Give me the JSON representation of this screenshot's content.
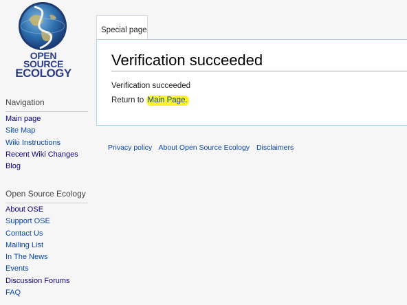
{
  "logo": {
    "line1": "OPEN",
    "line2": "SOURCE",
    "line3": "ECOLOGY"
  },
  "tabs": [
    {
      "label": "Special page"
    }
  ],
  "page": {
    "title": "Verification succeeded",
    "message": "Verification succeeded",
    "return_prefix": "Return to ",
    "return_link": "Main Page."
  },
  "sidebar": {
    "navigation": {
      "heading": "Navigation",
      "items": [
        {
          "label": "Main page"
        },
        {
          "label": "Site Map"
        },
        {
          "label": "Wiki Instructions"
        },
        {
          "label": "Recent Wiki Changes"
        },
        {
          "label": "Blog"
        }
      ]
    },
    "ose": {
      "heading": "Open Source Ecology",
      "items": [
        {
          "label": "About OSE"
        },
        {
          "label": "Support OSE"
        },
        {
          "label": "Contact Us"
        },
        {
          "label": "Mailing List"
        },
        {
          "label": "In The News"
        },
        {
          "label": "Events"
        },
        {
          "label": "Discussion Forums"
        },
        {
          "label": "FAQ"
        }
      ]
    }
  },
  "footer": {
    "links": [
      {
        "label": "Privacy policy"
      },
      {
        "label": "About Open Source Ecology"
      },
      {
        "label": "Disclaimers"
      }
    ]
  },
  "colors": {
    "link": "#0645ad",
    "visited_link": "#0b0080",
    "highlight": "#fbf42c",
    "logo_blue": "#2c3d8a"
  }
}
